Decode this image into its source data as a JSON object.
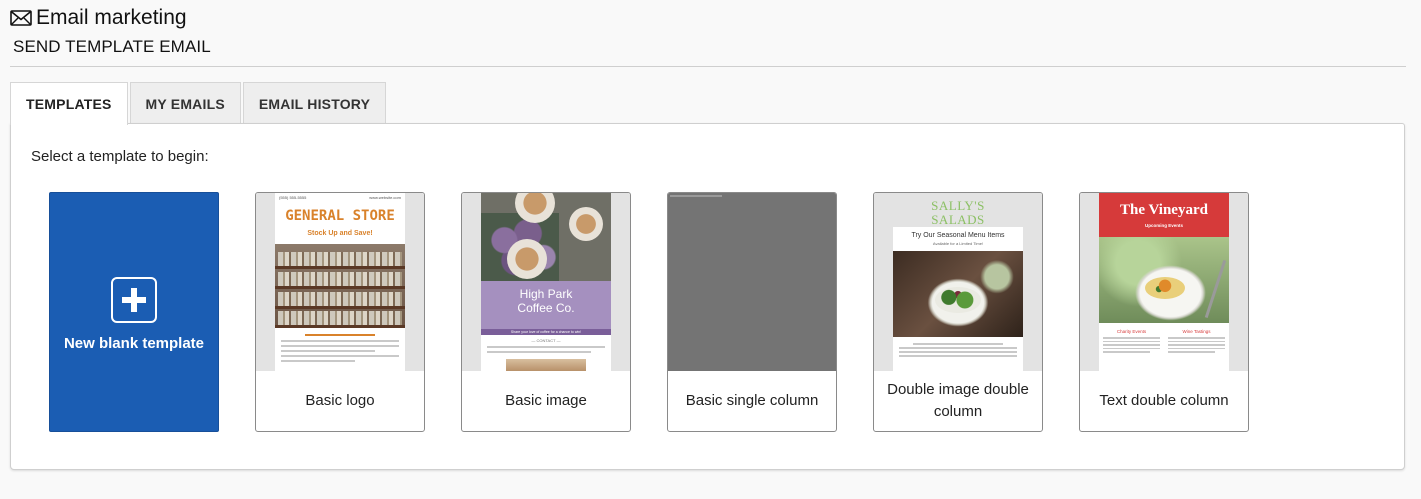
{
  "header": {
    "title": "Email marketing",
    "subtitle": "SEND TEMPLATE EMAIL"
  },
  "tabs": [
    {
      "label": "TEMPLATES",
      "active": true
    },
    {
      "label": "MY EMAILS",
      "active": false
    },
    {
      "label": "EMAIL HISTORY",
      "active": false
    }
  ],
  "panel": {
    "prompt": "Select a template to begin:"
  },
  "blank_template": {
    "label": "New blank template",
    "color": "#1b5db3"
  },
  "templates": [
    {
      "name": "Basic logo",
      "preview": {
        "phone": "(555) 555-5555",
        "website": "www.website.com",
        "title": "GENERAL STORE",
        "subtitle": "Stock Up and Save!",
        "accent": "#d9822b"
      }
    },
    {
      "name": "Basic image",
      "preview": {
        "title_line1": "High Park",
        "title_line2": "Coffee Co.",
        "tagline": "Share your love of coffee for a chance to win!",
        "contact": "— CONTACT —",
        "accent": "#a590bf"
      }
    },
    {
      "name": "Basic single column",
      "preview": {
        "background": "#747474"
      }
    },
    {
      "name": "Double image double column",
      "preview": {
        "title_line1": "SALLY'S",
        "title_line2": "SALADS",
        "headline": "Try Our Seasonal Menu Items",
        "subline": "Available for a Limited Time!",
        "accent": "#8cc065"
      }
    },
    {
      "name": "Text double column",
      "preview": {
        "title": "The Vineyard",
        "subtitle": "Upcoming Events",
        "col1": "Charity Events",
        "col2": "Wine Tastings",
        "accent": "#d63a3a"
      }
    }
  ]
}
